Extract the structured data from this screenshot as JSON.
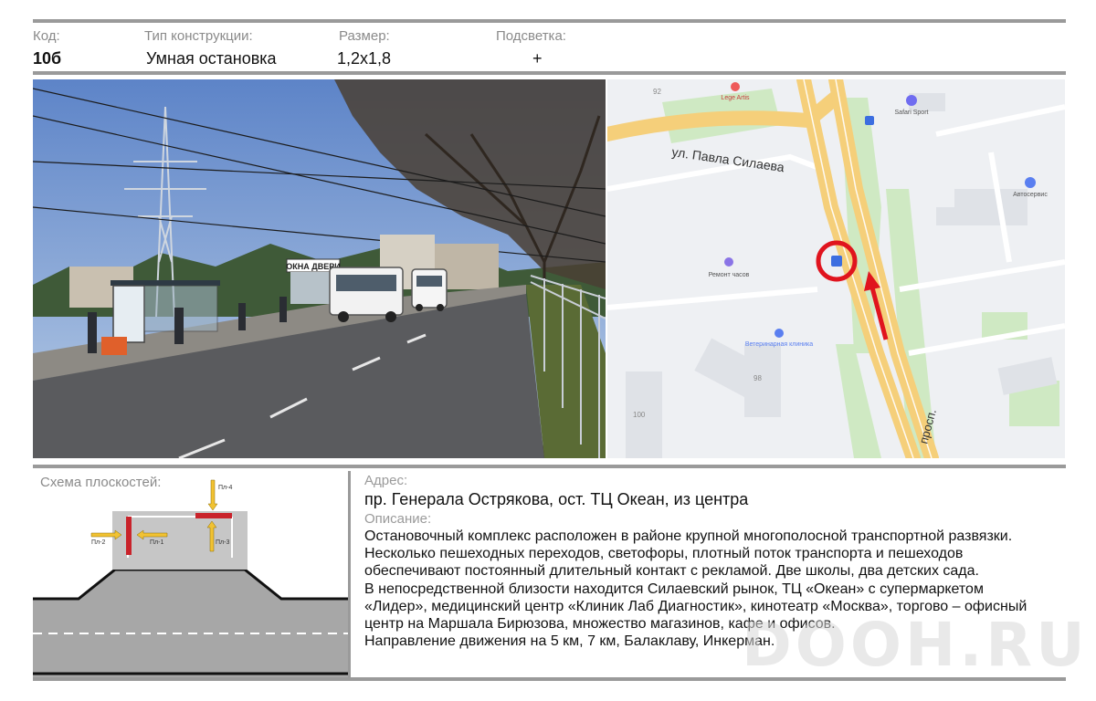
{
  "header": {
    "code_label": "Код:",
    "code_value": "10б",
    "type_label": "Тип конструкции:",
    "type_value": "Умная остановка",
    "size_label": "Размер:",
    "size_value": "1,2х1,8",
    "light_label": "Подсветка:",
    "light_value": "+"
  },
  "photo": {
    "sign_text": "ОКНА ДВЕРИ"
  },
  "map": {
    "street_1": "ул. Павла Силаева",
    "street_2": "просп.",
    "poi_1": "Lege Artis",
    "poi_2": "Safari Sport",
    "poi_3": "Автосервис",
    "poi_4": "Ремонт часов",
    "poi_5": "Ветеринарная клиника",
    "house_1": "92",
    "house_2": "98",
    "house_3": "100",
    "bus_icon_text": "🚌",
    "colors": {
      "road": "#f5cf7a",
      "green": "#cfe9c3",
      "marker": "#e0141e"
    }
  },
  "scheme": {
    "title": "Схема плоскостей:",
    "labels": {
      "p1": "Пл-1",
      "p2": "Пл-2",
      "p3": "Пл-3",
      "p4": "Пл-4"
    },
    "colors": {
      "plane": "#c9232b",
      "arrow": "#f1c232",
      "ground": "#a7a7a7"
    }
  },
  "details": {
    "address_label": "Адрес:",
    "address": "пр. Генерала Острякова, ост. ТЦ Океан, из центра",
    "description_label": "Описание:",
    "description_lines": [
      "Остановочный комплекс расположен в районе крупной  многополосной транспортной развязки.",
      "Несколько пешеходных переходов, светофоры, плотный поток транспорта и пешеходов",
      "обеспечивают постоянный длительный контакт с рекламой. Две школы, два детских сада.",
      "В непосредственной близости находится Силаевский рынок, ТЦ «Океан» с супермаркетом",
      "«Лидер», медицинский центр «Клиник Лаб Диагностик», кинотеатр «Москва», торгово – офисный",
      "центр на Маршала Бирюзова, множество магазинов, кафе и офисов.",
      "Направление движения на 5 км, 7 км, Балаклаву, Инкерман."
    ]
  },
  "watermark": "DOOH.RU"
}
